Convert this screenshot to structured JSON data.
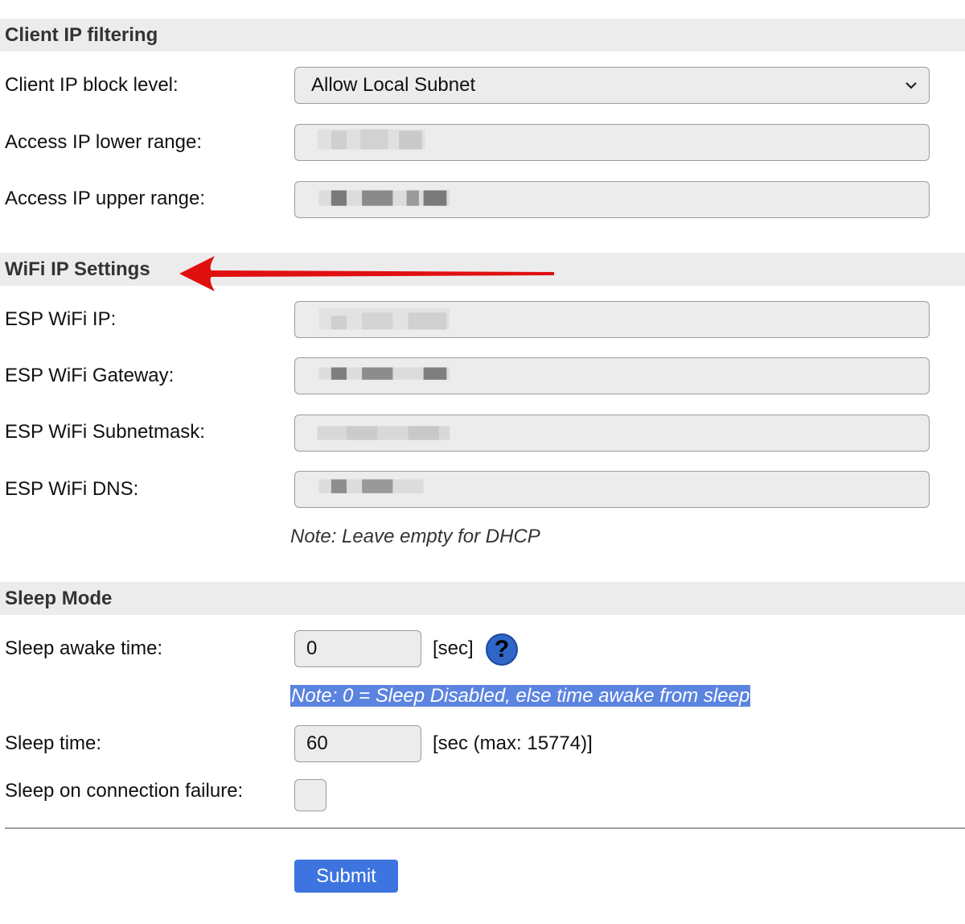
{
  "sections": {
    "client_ip_filtering": "Client IP filtering",
    "wifi_ip_settings": "WiFi IP Settings",
    "sleep_mode": "Sleep Mode"
  },
  "client_ip": {
    "block_level_label": "Client IP block level:",
    "block_level_value": "Allow Local Subnet",
    "lower_range_label": "Access IP lower range:",
    "upper_range_label": "Access IP upper range:"
  },
  "wifi": {
    "ip_label": "ESP WiFi IP:",
    "gateway_label": "ESP WiFi Gateway:",
    "subnetmask_label": "ESP WiFi Subnetmask:",
    "dns_label": "ESP WiFi DNS:",
    "note": "Note: Leave empty for DHCP"
  },
  "sleep": {
    "awake_label": "Sleep awake time:",
    "awake_value": "0",
    "awake_unit": "[sec]",
    "help_glyph": "?",
    "awake_note": "Note: 0 = Sleep Disabled, else time awake from sleep",
    "sleep_time_label": "Sleep time:",
    "sleep_time_value": "60",
    "sleep_time_unit": "[sec (max: 15774)]",
    "on_failure_label": "Sleep on connection failure:"
  },
  "submit_label": "Submit",
  "colors": {
    "section_bg": "#ececec",
    "field_bg": "#ececec",
    "submit_bg": "#3d74df",
    "highlight": "#5b83e0",
    "help_icon": "#2f66c8",
    "arrow": "#e01010"
  },
  "icons": {
    "select_chevron": "chevron-down-icon",
    "help": "help-icon",
    "annotation": "red-arrow-icon"
  }
}
